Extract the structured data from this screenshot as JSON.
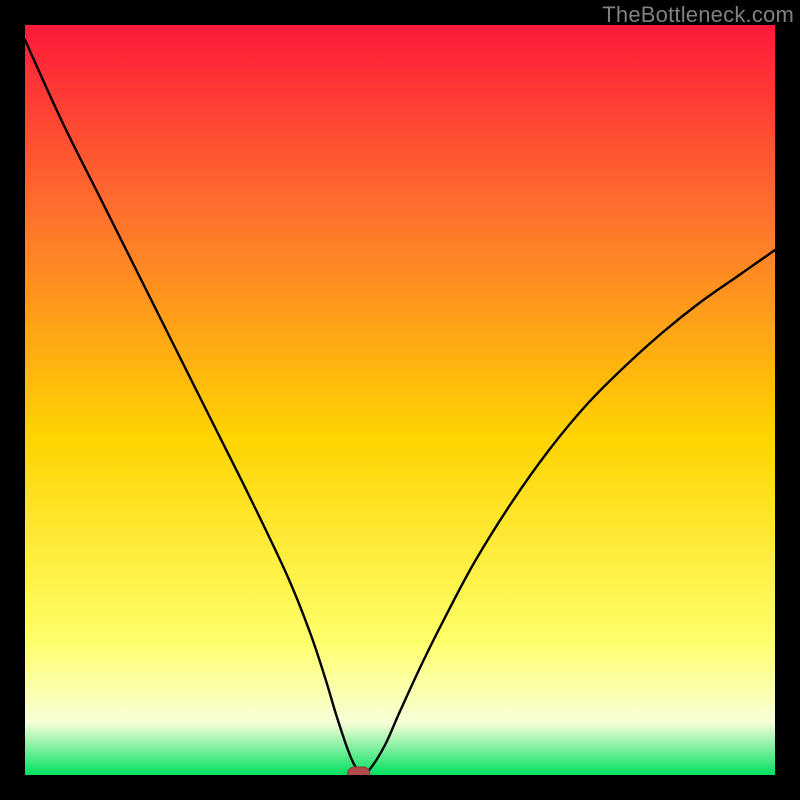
{
  "watermark": "TheBottleneck.com",
  "colors": {
    "frame": "#000000",
    "gradient_top": "#ff1a3a",
    "gradient_mid_upper": "#ff7a2a",
    "gradient_mid": "#ffd400",
    "gradient_mid_lower": "#ffff6a",
    "gradient_low_glow": "#f8ffd8",
    "gradient_bottom": "#00e060",
    "curve": "#000000",
    "marker_fill": "#b24a4a",
    "marker_stroke": "#8a3a3a"
  },
  "chart_data": {
    "type": "line",
    "title": "",
    "xlabel": "",
    "ylabel": "",
    "xlim": [
      0,
      100
    ],
    "ylim": [
      0,
      100
    ],
    "notes": "Bottleneck chart: gradient background red→yellow→green; black V-shaped curve with minimum at marker; axes unlabeled.",
    "series": [
      {
        "name": "bottleneck-curve",
        "x": [
          0,
          5,
          10,
          15,
          20,
          25,
          30,
          35,
          38,
          40,
          41.5,
          43,
          44,
          45,
          46,
          48,
          50,
          53,
          56,
          60,
          65,
          70,
          75,
          80,
          85,
          90,
          95,
          100
        ],
        "y": [
          98,
          87,
          77,
          67,
          57,
          47,
          37,
          26.5,
          19,
          13,
          8,
          3.5,
          1.2,
          0.2,
          0.8,
          4,
          8.5,
          15,
          21,
          28.5,
          36.5,
          43.5,
          49.5,
          54.5,
          59,
          63,
          66.5,
          70
        ]
      }
    ],
    "marker": {
      "x": 44.5,
      "y": 0.2,
      "shape": "rounded-rect"
    }
  }
}
